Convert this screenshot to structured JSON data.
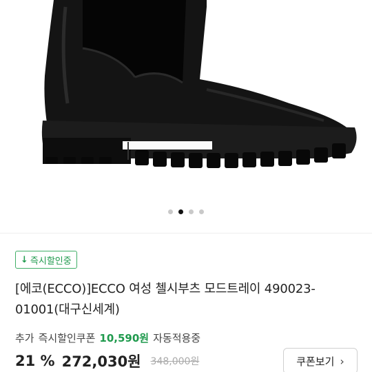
{
  "product": {
    "image_icon": "boot-photo",
    "carousel": {
      "count": 4,
      "active": 2
    }
  },
  "badge": {
    "icon": "down-arrow-icon",
    "arrow": "↓",
    "label": "즉시할인중",
    "color": "#1f9a4d"
  },
  "title": "[에코(ECCO)]ECCO 여성 첼시부츠 모드트레이 490023-01001(대구신세계)",
  "coupon": {
    "prefix": "추가",
    "label": "즉시할인쿠폰",
    "amount": "10,590원",
    "suffix": "자동적용중"
  },
  "price": {
    "discount": "21 %",
    "sale": "272,030원",
    "original": "348,000원"
  },
  "coupon_button": {
    "label": "쿠폰보기",
    "icon": "chevron-right-icon"
  }
}
